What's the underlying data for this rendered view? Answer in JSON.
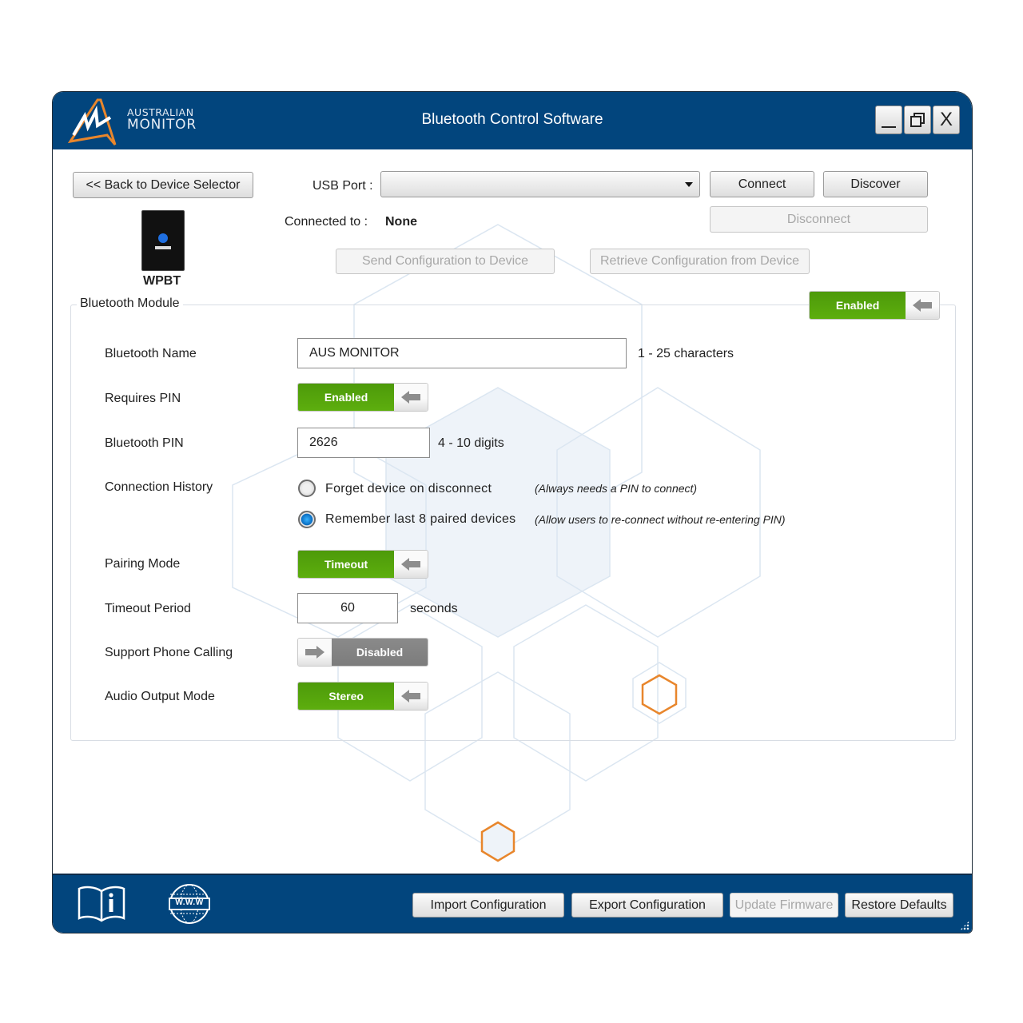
{
  "window": {
    "title": "Bluetooth Control Software",
    "logo": {
      "line1": "AUSTRALIAN",
      "line2": "MONITOR",
      "icon": "australian-monitor-logo"
    },
    "controls": {
      "minimize": "_",
      "maximize_icon": "restore-icon",
      "close": "X"
    }
  },
  "header": {
    "back_button": "<<  Back to Device Selector",
    "usb_port_label": "USB Port :",
    "usb_port_value": "",
    "connect_button": "Connect",
    "discover_button": "Discover",
    "disconnect_button": "Disconnect",
    "connected_to_label": "Connected to :",
    "connected_to_value": "None",
    "send_config_button": "Send Configuration to Device",
    "retrieve_config_button": "Retrieve Configuration from Device",
    "device_name": "WPBT"
  },
  "module": {
    "title": "Bluetooth Module",
    "enabled_toggle": {
      "state": "Enabled",
      "on": true
    },
    "rows": {
      "bluetooth_name": {
        "label": "Bluetooth Name",
        "value": "AUS MONITOR",
        "hint": "1 - 25 characters"
      },
      "requires_pin": {
        "label": "Requires PIN",
        "state": "Enabled",
        "on": true
      },
      "bluetooth_pin": {
        "label": "Bluetooth PIN",
        "value": "2626",
        "hint": "4 - 10 digits"
      },
      "connection_history": {
        "label": "Connection History",
        "options": [
          {
            "label": "Forget device on disconnect",
            "hint": "(Always needs a PIN to connect)",
            "selected": false
          },
          {
            "label": "Remember last 8 paired devices",
            "hint": "(Allow users to re-connect without re-entering PIN)",
            "selected": true
          }
        ]
      },
      "pairing_mode": {
        "label": "Pairing Mode",
        "state": "Timeout",
        "on": true
      },
      "timeout_period": {
        "label": "Timeout Period",
        "value": "60",
        "unit": "seconds"
      },
      "support_phone_calling": {
        "label": "Support Phone Calling",
        "state": "Disabled",
        "on": false
      },
      "audio_output_mode": {
        "label": "Audio Output Mode",
        "state": "Stereo",
        "on": true
      }
    }
  },
  "footer": {
    "manual_icon": "book-info-icon",
    "web_icon": "www-globe-icon",
    "web_icon_text": "W.W.W",
    "import_button": "Import Configuration",
    "export_button": "Export Configuration",
    "update_firmware_button": "Update Firmware",
    "restore_defaults_button": "Restore Defaults"
  },
  "colors": {
    "header_bg": "#02457d",
    "toggle_on": "#5dae0e",
    "toggle_off": "#808080",
    "accent_orange": "#e8862c"
  }
}
